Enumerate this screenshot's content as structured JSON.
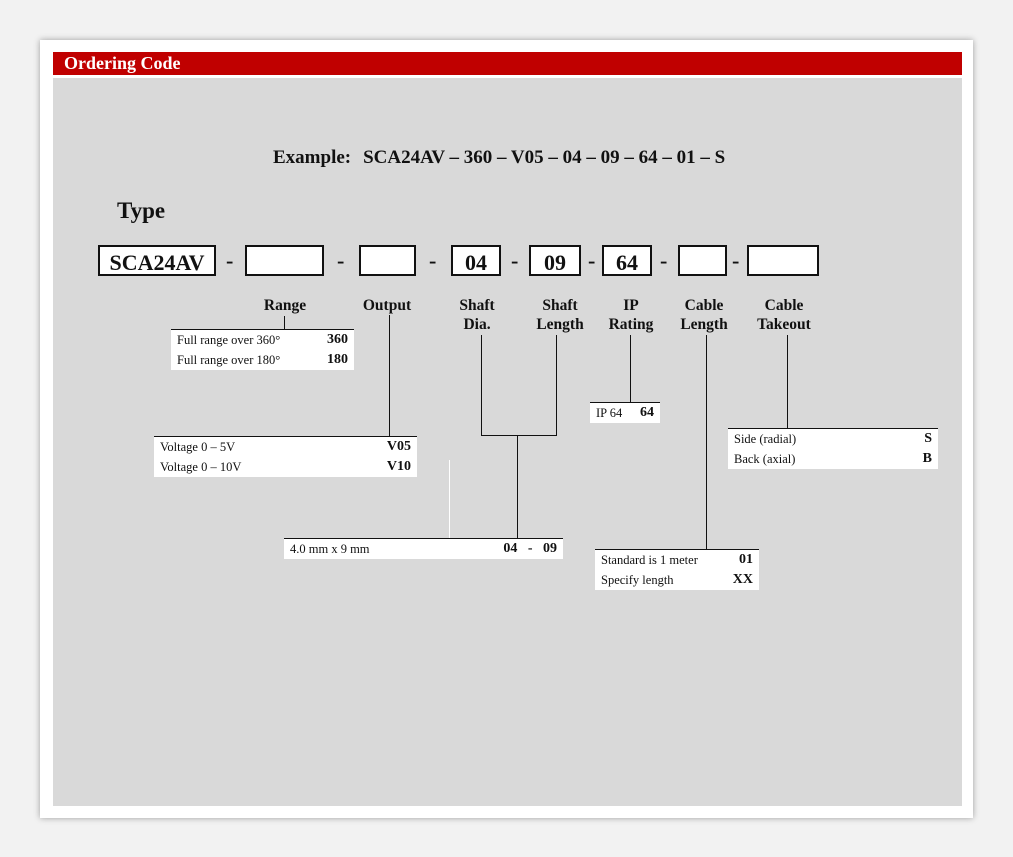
{
  "header": {
    "title": "Ordering Code"
  },
  "example": {
    "label": "Example:",
    "code": "SCA24AV – 360 – V05 – 04 – 09 – 64 – 01 – S"
  },
  "type_label": "Type",
  "code_boxes": [
    "SCA24AV",
    "",
    "",
    "04",
    "09",
    "64",
    "",
    ""
  ],
  "dash": "-",
  "columns": {
    "range": "Range",
    "output": "Output",
    "shaft_dia": [
      "Shaft",
      "Dia."
    ],
    "shaft_length": [
      "Shaft",
      "Length"
    ],
    "ip_rating": [
      "IP",
      "Rating"
    ],
    "cable_length": [
      "Cable",
      "Length"
    ],
    "cable_takeout": [
      "Cable",
      "Takeout"
    ]
  },
  "range_table": [
    {
      "desc": "Full range over 360°",
      "code": "360"
    },
    {
      "desc": "Full range over 180°",
      "code": "180"
    }
  ],
  "output_table": [
    {
      "desc": "Voltage   0 – 5V",
      "code": "V05"
    },
    {
      "desc": "Voltage   0 – 10V",
      "code": "V10"
    }
  ],
  "shaft_table": [
    {
      "desc": "4.0 mm   x  9 mm",
      "code": "04   -   09"
    }
  ],
  "ip_table": [
    {
      "desc": "IP 64",
      "code": "64"
    }
  ],
  "cable_length_table": [
    {
      "desc": "Standard is 1 meter",
      "code": "01"
    },
    {
      "desc": "Specify length",
      "code": "XX"
    }
  ],
  "cable_takeout_table": [
    {
      "desc": "Side  (radial)",
      "code": "S"
    },
    {
      "desc": "Back  (axial)",
      "code": "B"
    }
  ],
  "colors": {
    "title_bar": "#c00000",
    "panel": "#d9d9d9"
  }
}
